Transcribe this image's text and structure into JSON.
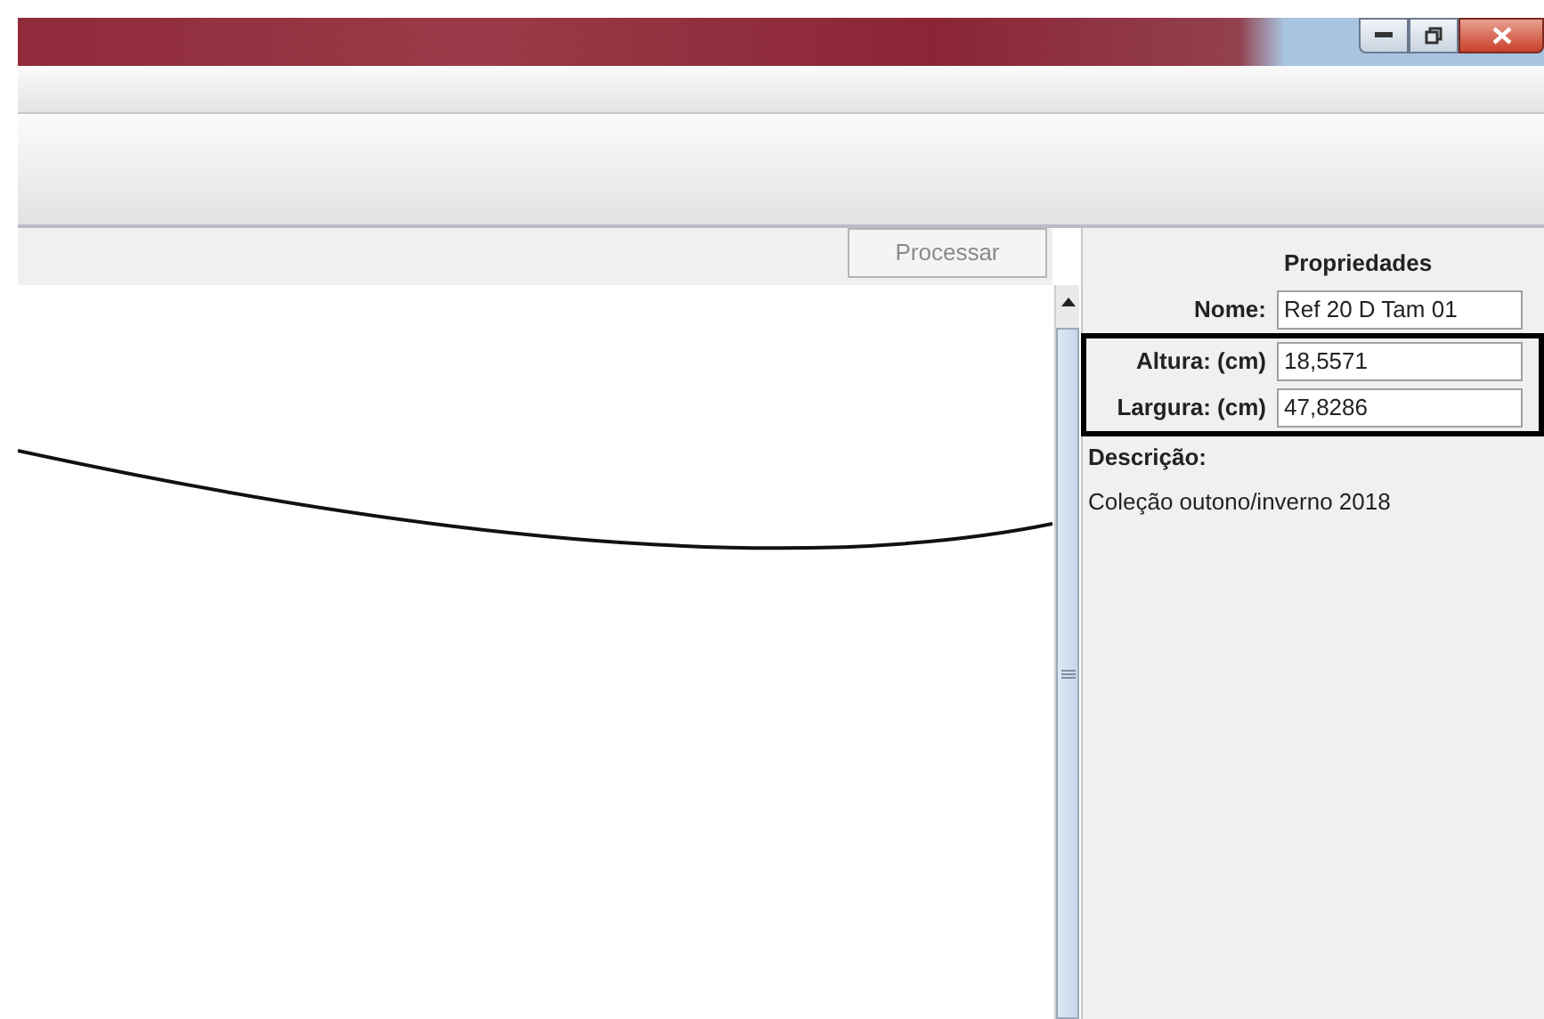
{
  "toolbar": {
    "process_button": {
      "label": "Processar",
      "disabled": true
    }
  },
  "properties": {
    "title": "Propriedades",
    "fields": [
      {
        "label": "Nome:",
        "value": "Ref 20 D Tam 01"
      }
    ],
    "framed_fields": [
      {
        "label": "Altura: (cm)",
        "value": "18,5571"
      },
      {
        "label": "Largura: (cm)",
        "value": "47,8286"
      }
    ],
    "description_label": "Descrição:",
    "description": "Coleção outono/inverno 2018"
  }
}
